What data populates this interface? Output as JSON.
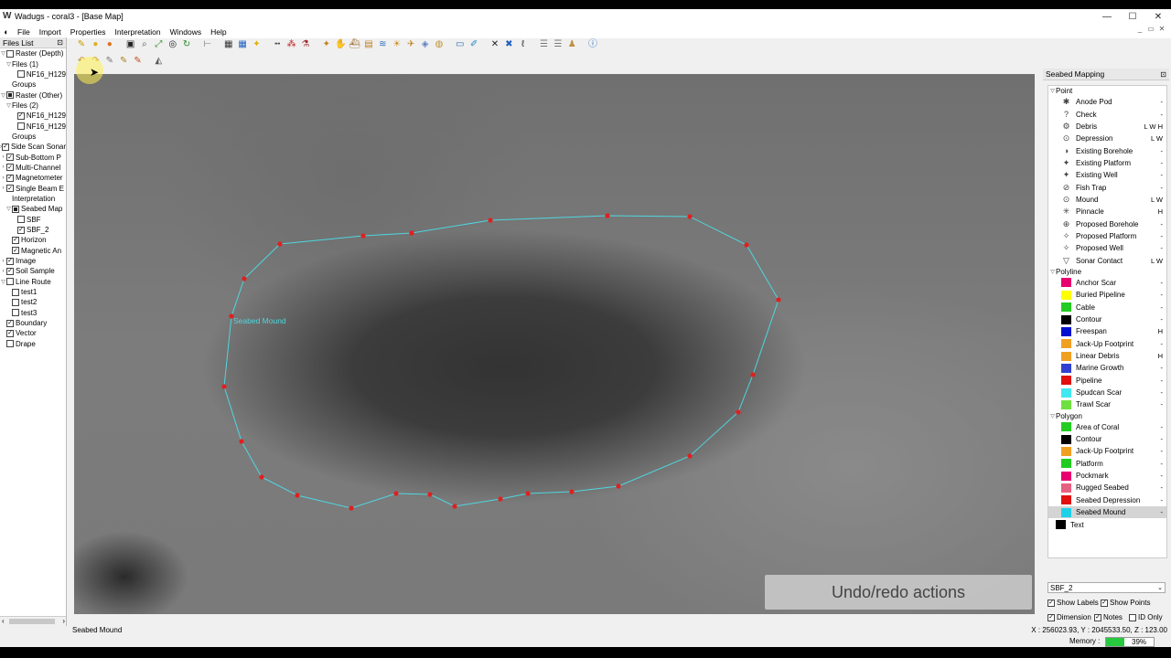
{
  "window": {
    "title": "Wadugs - coral3 - [Base Map]",
    "app_glyph": "W",
    "min": "—",
    "max": "☐",
    "close": "✕"
  },
  "menu": [
    "File",
    "Import",
    "Properties",
    "Interpretation",
    "Windows",
    "Help"
  ],
  "mdi_controls": {
    "min": "_",
    "restore": "▭",
    "close": "✕"
  },
  "files_list": {
    "title": "Files List",
    "rows": [
      {
        "level": 0,
        "exp": "▽",
        "check": "off",
        "label": "Raster (Depth)"
      },
      {
        "level": 1,
        "exp": "▽",
        "check": "none",
        "label": "Files (1)"
      },
      {
        "level": 2,
        "exp": "",
        "check": "off",
        "label": "NF16_H129"
      },
      {
        "level": 1,
        "exp": "",
        "check": "none",
        "label": "Groups"
      },
      {
        "level": 0,
        "exp": "▽",
        "check": "fill",
        "label": "Raster (Other)"
      },
      {
        "level": 1,
        "exp": "▽",
        "check": "none",
        "label": "Files (2)"
      },
      {
        "level": 2,
        "exp": "",
        "check": "on",
        "label": "NF16_H129"
      },
      {
        "level": 2,
        "exp": "",
        "check": "off",
        "label": "NF16_H129"
      },
      {
        "level": 1,
        "exp": "",
        "check": "none",
        "label": "Groups"
      },
      {
        "level": 0,
        "exp": "›",
        "check": "on",
        "label": "Side Scan Sonar"
      },
      {
        "level": 0,
        "exp": "›",
        "check": "on",
        "label": "Sub-Bottom P"
      },
      {
        "level": 0,
        "exp": "›",
        "check": "on",
        "label": "Multi-Channel"
      },
      {
        "level": 0,
        "exp": "›",
        "check": "on",
        "label": "Magnetometer"
      },
      {
        "level": 0,
        "exp": "›",
        "check": "on",
        "label": "Single Beam E"
      },
      {
        "level": 1,
        "exp": "",
        "check": "none",
        "label": "Interpretation"
      },
      {
        "level": 1,
        "exp": "▽",
        "check": "fill",
        "label": "Seabed Map"
      },
      {
        "level": 2,
        "exp": "",
        "check": "off",
        "label": "SBF"
      },
      {
        "level": 2,
        "exp": "",
        "check": "on",
        "label": "SBF_2"
      },
      {
        "level": 1,
        "exp": "",
        "check": "on",
        "label": "Horizon"
      },
      {
        "level": 1,
        "exp": "",
        "check": "on",
        "label": "Magnetic An"
      },
      {
        "level": 0,
        "exp": "›",
        "check": "on",
        "label": "Image"
      },
      {
        "level": 0,
        "exp": "›",
        "check": "on",
        "label": "Soil Sample"
      },
      {
        "level": 0,
        "exp": "▽",
        "check": "off",
        "label": "Line Route"
      },
      {
        "level": 1,
        "exp": "",
        "check": "off",
        "label": "test1"
      },
      {
        "level": 1,
        "exp": "",
        "check": "off",
        "label": "test2"
      },
      {
        "level": 1,
        "exp": "",
        "check": "off",
        "label": "test3"
      },
      {
        "level": 0,
        "exp": "",
        "check": "on",
        "label": "Boundary"
      },
      {
        "level": 0,
        "exp": "",
        "check": "on",
        "label": "Vector"
      },
      {
        "level": 0,
        "exp": "",
        "check": "off",
        "label": "Drape"
      }
    ]
  },
  "toolbar1": [
    {
      "icon": "pencil-icon",
      "glyph": "✎",
      "color": "#c8a000"
    },
    {
      "icon": "globe-icon",
      "glyph": "●",
      "color": "#e0b020"
    },
    {
      "icon": "layers-icon",
      "glyph": "●",
      "color": "#e07020"
    },
    {
      "icon": "sep",
      "glyph": "",
      "color": ""
    },
    {
      "icon": "frame-icon",
      "glyph": "▣",
      "color": "#222"
    },
    {
      "icon": "zoom-icon",
      "glyph": "⌕",
      "color": "#555"
    },
    {
      "icon": "fit-icon",
      "glyph": "⤢",
      "color": "#2a8a2a"
    },
    {
      "icon": "target-icon",
      "glyph": "◎",
      "color": "#222"
    },
    {
      "icon": "refresh-icon",
      "glyph": "↻",
      "color": "#2a8a2a"
    },
    {
      "icon": "sep",
      "glyph": "",
      "color": ""
    },
    {
      "icon": "ruler-icon",
      "glyph": "⊢",
      "color": "#777"
    },
    {
      "icon": "sep",
      "glyph": "",
      "color": ""
    },
    {
      "icon": "grid-icon",
      "glyph": "▦",
      "color": "#333"
    },
    {
      "icon": "grid-select-icon",
      "glyph": "▦",
      "color": "#2060c0"
    },
    {
      "icon": "bulb-icon",
      "glyph": "✦",
      "color": "#e0b000"
    },
    {
      "icon": "sep",
      "glyph": "",
      "color": ""
    },
    {
      "icon": "line-icon",
      "glyph": "╍",
      "color": "#444"
    },
    {
      "icon": "dots-icon",
      "glyph": "⁂",
      "color": "#c02020"
    },
    {
      "icon": "flask-icon",
      "glyph": "⚗",
      "color": "#a03030"
    },
    {
      "icon": "sep",
      "glyph": "",
      "color": ""
    },
    {
      "icon": "wand-icon",
      "glyph": "✦",
      "color": "#c08020"
    },
    {
      "icon": "hand-icon",
      "glyph": "✋",
      "color": "#d09020"
    },
    {
      "icon": "boat-icon",
      "glyph": "⛴",
      "color": "#a07030"
    },
    {
      "icon": "stack-icon",
      "glyph": "▤",
      "color": "#c08020"
    },
    {
      "icon": "wave-icon",
      "glyph": "≋",
      "color": "#3070c0"
    },
    {
      "icon": "sun-icon",
      "glyph": "☀",
      "color": "#d09020"
    },
    {
      "icon": "bird-icon",
      "glyph": "✈",
      "color": "#c08020"
    },
    {
      "icon": "fish-icon",
      "glyph": "◈",
      "color": "#6080c0"
    },
    {
      "icon": "ring-icon",
      "glyph": "◍",
      "color": "#c09030"
    },
    {
      "icon": "sep",
      "glyph": "",
      "color": ""
    },
    {
      "icon": "image-icon",
      "glyph": "▭",
      "color": "#2a6ab0"
    },
    {
      "icon": "brush-icon",
      "glyph": "✐",
      "color": "#2a8ac0"
    },
    {
      "icon": "sep",
      "glyph": "",
      "color": ""
    },
    {
      "icon": "cross-icon",
      "glyph": "✕",
      "color": "#222"
    },
    {
      "icon": "cross-box-icon",
      "glyph": "✖",
      "color": "#2060c0"
    },
    {
      "icon": "text-icon",
      "glyph": "ℓ",
      "color": "#333"
    },
    {
      "icon": "sep",
      "glyph": "",
      "color": ""
    },
    {
      "icon": "rows-icon",
      "glyph": "☰",
      "color": "#777"
    },
    {
      "icon": "rows2-icon",
      "glyph": "☰",
      "color": "#777"
    },
    {
      "icon": "person-icon",
      "glyph": "♟",
      "color": "#c09040"
    },
    {
      "icon": "sep",
      "glyph": "",
      "color": ""
    },
    {
      "icon": "info-icon",
      "glyph": "ⓘ",
      "color": "#2070d0"
    }
  ],
  "toolbar2": [
    {
      "icon": "undo-icon",
      "glyph": "↶",
      "color": "#c09020"
    },
    {
      "icon": "redo-icon",
      "glyph": "↷",
      "color": "#c09020"
    },
    {
      "icon": "edit-shape-icon",
      "glyph": "✎",
      "color": "#777"
    },
    {
      "icon": "edit-pen-icon",
      "glyph": "✎",
      "color": "#b08020"
    },
    {
      "icon": "edit-color-icon",
      "glyph": "✎",
      "color": "#c05020"
    },
    {
      "icon": "sep",
      "glyph": "",
      "color": ""
    },
    {
      "icon": "measure-icon",
      "glyph": "◭",
      "color": "#555"
    }
  ],
  "map": {
    "feature_label": "Seabed Mound",
    "polygon_color": "#4fd6e0",
    "vertex_color": "#e02020"
  },
  "overlay_caption": "Undo/redo actions",
  "seabed_panel": {
    "title": "Seabed Mapping",
    "groups": [
      {
        "name": "Point",
        "items": [
          {
            "label": "Anode Pod",
            "icon": "✱",
            "flag": "-"
          },
          {
            "label": "Check",
            "icon": "?",
            "flag": "-"
          },
          {
            "label": "Debris",
            "icon": "⚙",
            "flag": "L W H"
          },
          {
            "label": "Depression",
            "icon": "⊙",
            "flag": "L W"
          },
          {
            "label": "Existing Borehole",
            "icon": "◑",
            "flag": "-"
          },
          {
            "label": "Existing Platform",
            "icon": "✦",
            "flag": "-"
          },
          {
            "label": "Existing Well",
            "icon": "✦",
            "flag": "-"
          },
          {
            "label": "Fish Trap",
            "icon": "⊘",
            "flag": "-"
          },
          {
            "label": "Mound",
            "icon": "⊙",
            "flag": "L W"
          },
          {
            "label": "Pinnacle",
            "icon": "✳",
            "flag": "H"
          },
          {
            "label": "Proposed Borehole",
            "icon": "⊕",
            "flag": "-"
          },
          {
            "label": "Proposed Platform",
            "icon": "✧",
            "flag": "-"
          },
          {
            "label": "Proposed Well",
            "icon": "✧",
            "flag": "-"
          },
          {
            "label": "Sonar Contact",
            "icon": "▽",
            "flag": "L W"
          }
        ]
      },
      {
        "name": "Polyline",
        "items": [
          {
            "label": "Anchor Scar",
            "swatch": "#e8006e",
            "flag": "-"
          },
          {
            "label": "Buried Pipeline",
            "swatch": "#ffff00",
            "flag": "-"
          },
          {
            "label": "Cable",
            "swatch": "#22cc22",
            "flag": "-"
          },
          {
            "label": "Contour",
            "swatch": "#000000",
            "flag": "-"
          },
          {
            "label": "Freespan",
            "swatch": "#0010d0",
            "flag": "H"
          },
          {
            "label": "Jack-Up Footprint",
            "swatch": "#f0a020",
            "flag": "-"
          },
          {
            "label": "Linear Debris",
            "swatch": "#f0a020",
            "flag": "H"
          },
          {
            "label": "Marine Growth",
            "swatch": "#3040d0",
            "flag": "-"
          },
          {
            "label": "Pipeline",
            "swatch": "#e01010",
            "flag": "-"
          },
          {
            "label": "Spudcan Scar",
            "swatch": "#40e8f0",
            "flag": "-"
          },
          {
            "label": "Trawl Scar",
            "swatch": "#70e040",
            "flag": "-"
          }
        ]
      },
      {
        "name": "Polygon",
        "items": [
          {
            "label": "Area of Coral",
            "swatch": "#22cc22",
            "flag": "-"
          },
          {
            "label": "Contour",
            "swatch": "#000000",
            "flag": "-"
          },
          {
            "label": "Jack-Up Footprint",
            "swatch": "#f0a020",
            "flag": "-"
          },
          {
            "label": "Platform",
            "swatch": "#22cc22",
            "flag": "-"
          },
          {
            "label": "Pockmark",
            "swatch": "#e8006e",
            "flag": "-"
          },
          {
            "label": "Rugged Seabed",
            "swatch": "#e86080",
            "flag": "-"
          },
          {
            "label": "Seabed Depression",
            "swatch": "#e01010",
            "flag": "-"
          },
          {
            "label": "Seabed Mound",
            "swatch": "#20d0e8",
            "flag": "-",
            "selected": true
          }
        ]
      }
    ],
    "text_item": {
      "label": "Text",
      "swatch": "#000000"
    },
    "dataset_select": "SBF_2",
    "options": {
      "show_labels": "Show Labels",
      "show_points": "Show Points",
      "dimension": "Dimension",
      "notes": "Notes",
      "id_only": "ID Only"
    }
  },
  "status": {
    "selected_label": "Seabed Mound",
    "coords": "X : 256023.93, Y : 2045533.50, Z : 123.00",
    "memory_label": "Memory :",
    "memory_percent": "39%",
    "memory_fraction": 0.39
  }
}
